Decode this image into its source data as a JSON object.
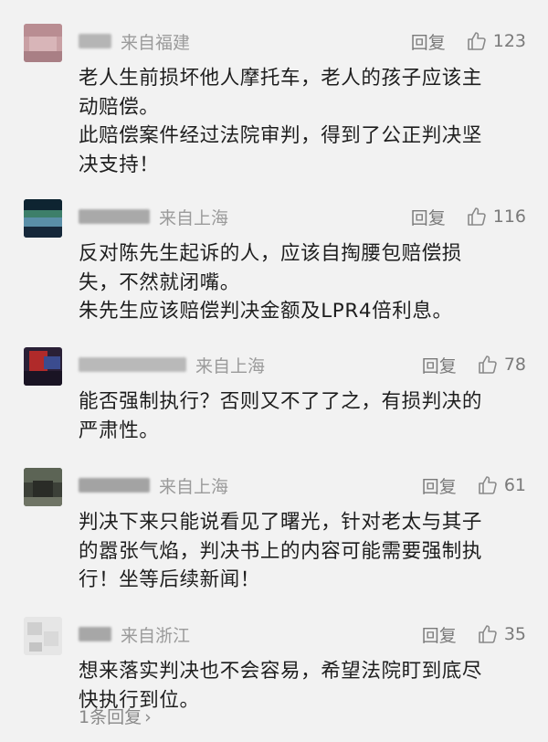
{
  "comments": [
    {
      "location": "来自福建",
      "reply_label": "回复",
      "likes": "123",
      "lines": [
        "老人生前损坏他人摩托车，老人的孩子应该主",
        "动赔偿。",
        "此赔偿案件经过法院审判，得到了公正判决坚",
        "决支持！"
      ]
    },
    {
      "location": "来自上海",
      "reply_label": "回复",
      "likes": "116",
      "lines": [
        "反对陈先生起诉的人，应该自掏腰包赔偿损",
        "失，不然就闭嘴。",
        "朱先生应该赔偿判决金额及LPR4倍利息。"
      ]
    },
    {
      "location": "来自上海",
      "reply_label": "回复",
      "likes": "78",
      "lines": [
        "能否强制执行？否则又不了了之，有损判决的",
        "严肃性。"
      ]
    },
    {
      "location": "来自上海",
      "reply_label": "回复",
      "likes": "61",
      "lines": [
        "判决下来只能说看见了曙光，针对老太与其子",
        "的嚣张气焰，判决书上的内容可能需要强制执",
        "行！坐等后续新闻！"
      ]
    },
    {
      "location": "来自浙江",
      "reply_label": "回复",
      "likes": "35",
      "lines": [
        "想来落实判决也不会容易，希望法院盯到底尽",
        "快执行到位。"
      ],
      "replies_link": "1条回复"
    }
  ],
  "icons": {
    "like": "thumbs-up-icon",
    "chevron": "chevron-right-icon"
  },
  "colors": {
    "background": "#f2f2f2",
    "meta_text": "#9b9b9b",
    "body_text": "#1e1e1e"
  }
}
